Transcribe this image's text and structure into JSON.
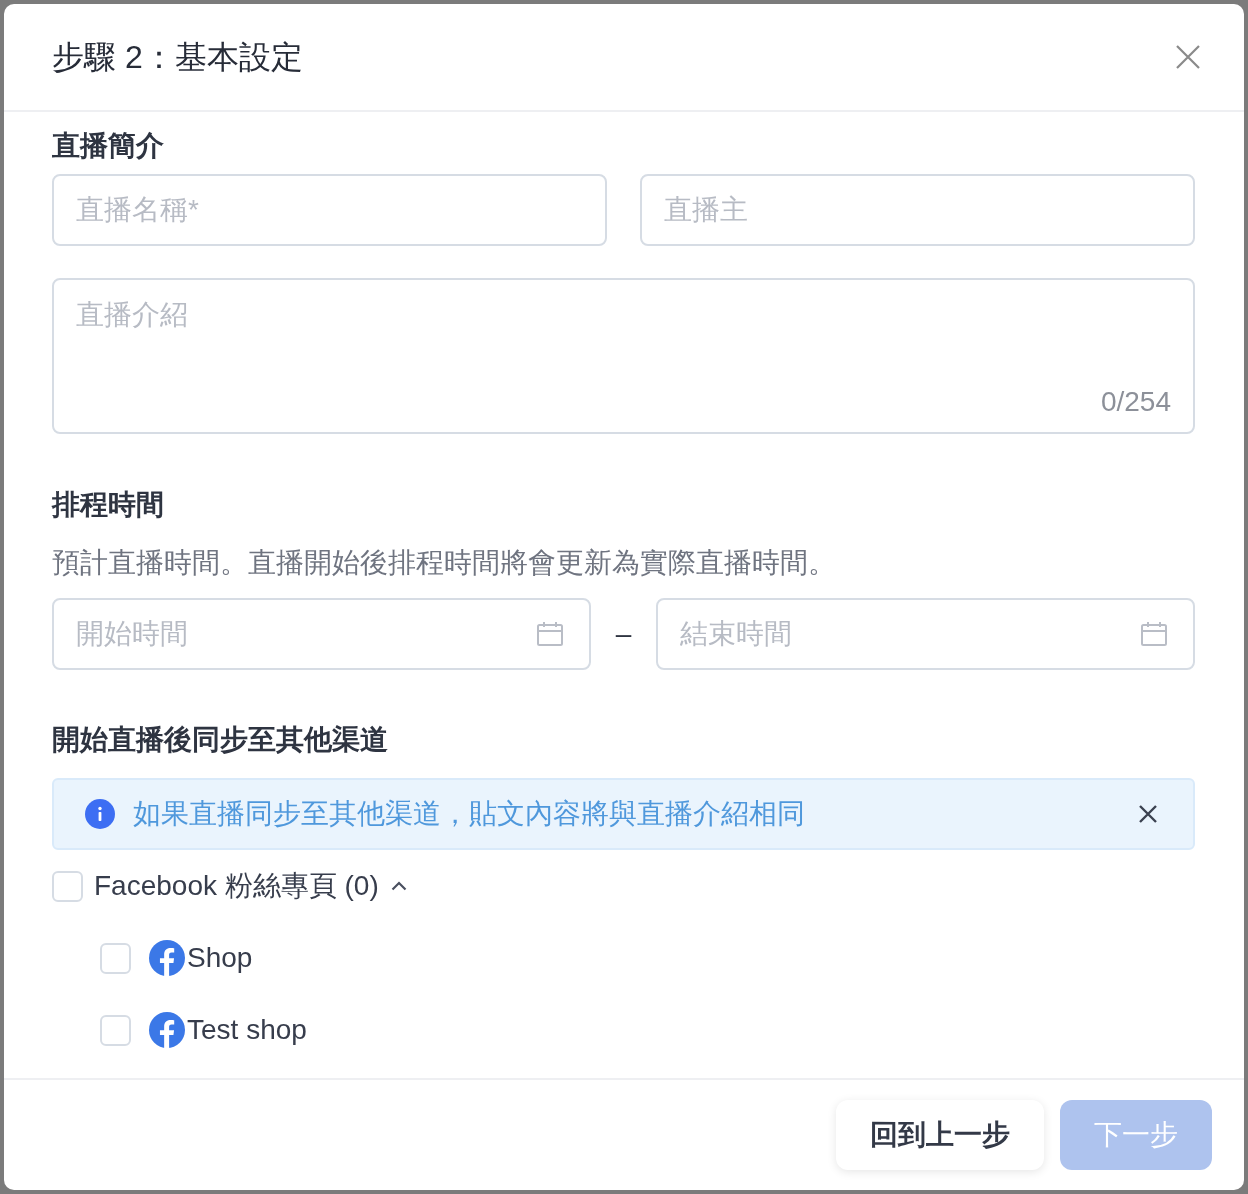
{
  "dialog": {
    "title": "步驟 2：基本設定"
  },
  "intro_section": {
    "heading": "直播簡介",
    "name_field": {
      "placeholder": "直播名稱*"
    },
    "host_field": {
      "placeholder": "直播主"
    },
    "description_field": {
      "placeholder": "直播介紹",
      "counter": "0/254"
    }
  },
  "schedule_section": {
    "heading": "排程時間",
    "hint": "預計直播時間。直播開始後排程時間將會更新為實際直播時間。",
    "start_field": {
      "placeholder": "開始時間"
    },
    "separator": "–",
    "end_field": {
      "placeholder": "結束時間"
    }
  },
  "sync_section": {
    "heading": "開始直播後同步至其他渠道",
    "notice": {
      "text": "如果直播同步至其他渠道，貼文內容將與直播介紹相同"
    },
    "groups": [
      {
        "label": "Facebook 粉絲專頁 (0)",
        "checked": false,
        "expanded": true,
        "pages": [
          {
            "name": "Shop",
            "checked": false
          },
          {
            "name": "Test shop",
            "checked": false
          }
        ]
      }
    ]
  },
  "footer": {
    "buttons": [
      {
        "label": "回到上一步",
        "kind": "secondary",
        "disabled": false
      },
      {
        "label": "下一步",
        "kind": "primary",
        "disabled": true
      }
    ]
  }
}
